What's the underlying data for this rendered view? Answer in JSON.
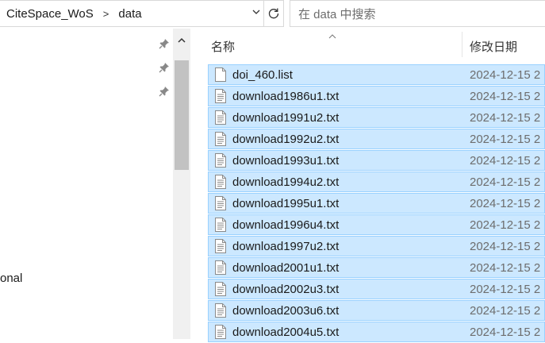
{
  "address": {
    "segments": [
      "CiteSpace_WoS",
      "data"
    ],
    "separator": ">"
  },
  "search": {
    "placeholder": "在 data 中搜索"
  },
  "nav": {
    "partial_label": "onal"
  },
  "columns": {
    "name": "名称",
    "date_modified": "修改日期"
  },
  "files": [
    {
      "name": "doi_460.list",
      "date": "2024-12-15 2",
      "icon": "blank-file-icon"
    },
    {
      "name": "download1986u1.txt",
      "date": "2024-12-15 2",
      "icon": "text-file-icon"
    },
    {
      "name": "download1991u2.txt",
      "date": "2024-12-15 2",
      "icon": "text-file-icon"
    },
    {
      "name": "download1992u2.txt",
      "date": "2024-12-15 2",
      "icon": "text-file-icon"
    },
    {
      "name": "download1993u1.txt",
      "date": "2024-12-15 2",
      "icon": "text-file-icon"
    },
    {
      "name": "download1994u2.txt",
      "date": "2024-12-15 2",
      "icon": "text-file-icon"
    },
    {
      "name": "download1995u1.txt",
      "date": "2024-12-15 2",
      "icon": "text-file-icon"
    },
    {
      "name": "download1996u4.txt",
      "date": "2024-12-15 2",
      "icon": "text-file-icon"
    },
    {
      "name": "download1997u2.txt",
      "date": "2024-12-15 2",
      "icon": "text-file-icon"
    },
    {
      "name": "download2001u1.txt",
      "date": "2024-12-15 2",
      "icon": "text-file-icon"
    },
    {
      "name": "download2002u3.txt",
      "date": "2024-12-15 2",
      "icon": "text-file-icon"
    },
    {
      "name": "download2003u6.txt",
      "date": "2024-12-15 2",
      "icon": "text-file-icon"
    },
    {
      "name": "download2004u5.txt",
      "date": "2024-12-15 2",
      "icon": "text-file-icon"
    }
  ],
  "colors": {
    "selection_bg": "#cce8ff",
    "selection_border": "#99d1ff"
  }
}
